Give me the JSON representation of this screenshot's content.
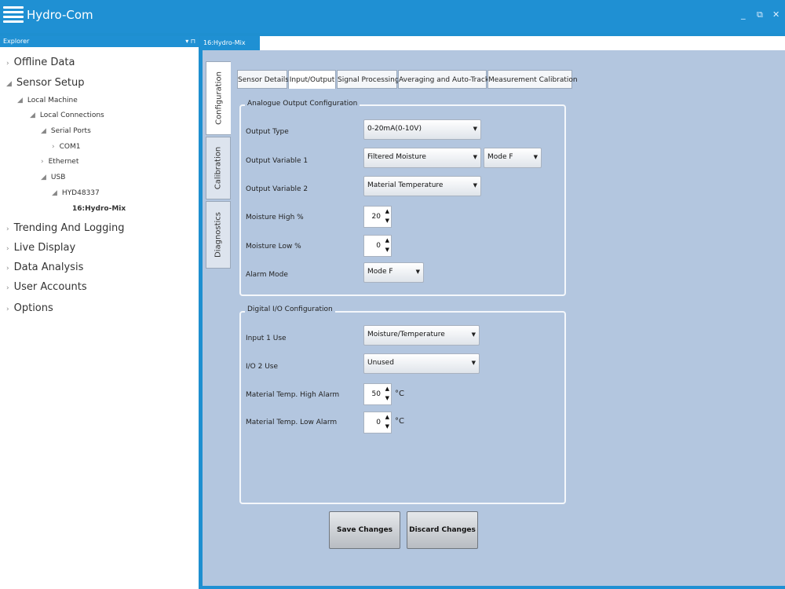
{
  "window": {
    "title": "Hydro-Com",
    "controls": {
      "minimize": "_",
      "maximize": "⧉",
      "close": "✕"
    }
  },
  "explorer": {
    "header": "Explorer",
    "pin": "▾ ⊓",
    "items": [
      {
        "label": "Offline Data",
        "mark": "›"
      },
      {
        "label": "Sensor Setup",
        "mark": "◢"
      },
      {
        "label": "Local Machine",
        "mark": "◢"
      },
      {
        "label": "Local Connections",
        "mark": "◢"
      },
      {
        "label": "Serial Ports",
        "mark": "◢"
      },
      {
        "label": "COM1",
        "mark": "›"
      },
      {
        "label": "Ethernet",
        "mark": "›"
      },
      {
        "label": "USB",
        "mark": "◢"
      },
      {
        "label": "HYD48337",
        "mark": "◢"
      },
      {
        "label": "16:Hydro-Mix",
        "mark": ""
      },
      {
        "label": "Trending And Logging",
        "mark": "›"
      },
      {
        "label": "Live Display",
        "mark": "›"
      },
      {
        "label": "Data Analysis",
        "mark": "›"
      },
      {
        "label": "User Accounts",
        "mark": "›"
      },
      {
        "label": "Options",
        "mark": "›"
      }
    ]
  },
  "document_tab": "16:Hydro-Mix",
  "side_tabs": [
    "Configuration",
    "Calibration",
    "Diagnostics"
  ],
  "inner_tabs": [
    "Sensor Details",
    "Input/Output",
    "Signal Processing",
    "Averaging and Auto-Track",
    "Measurement Calibration"
  ],
  "analogue": {
    "title": "Analogue Output Configuration",
    "output_type_label": "Output Type",
    "output_type_value": "0-20mA(0-10V)",
    "var1_label": "Output Variable 1",
    "var1_value": "Filtered Moisture",
    "var1_mode_value": "Mode F",
    "var2_label": "Output Variable 2",
    "var2_value": "Material Temperature",
    "moisture_high_label": "Moisture High %",
    "moisture_high_value": "20",
    "moisture_low_label": "Moisture Low %",
    "moisture_low_value": "0",
    "alarm_mode_label": "Alarm Mode",
    "alarm_mode_value": "Mode F"
  },
  "digital": {
    "title": "Digital I/O Configuration",
    "input1_label": "Input 1 Use",
    "input1_value": "Moisture/Temperature",
    "io2_label": "I/O 2 Use",
    "io2_value": "Unused",
    "temp_high_label": "Material Temp. High Alarm",
    "temp_high_value": "50",
    "temp_low_label": "Material Temp. Low Alarm",
    "temp_low_value": "0",
    "unit": "°C"
  },
  "buttons": {
    "save": "Save Changes",
    "discard": "Discard Changes"
  },
  "icons": {
    "dropdown": "▼",
    "spin_up": "▲",
    "spin_down": "▼"
  }
}
